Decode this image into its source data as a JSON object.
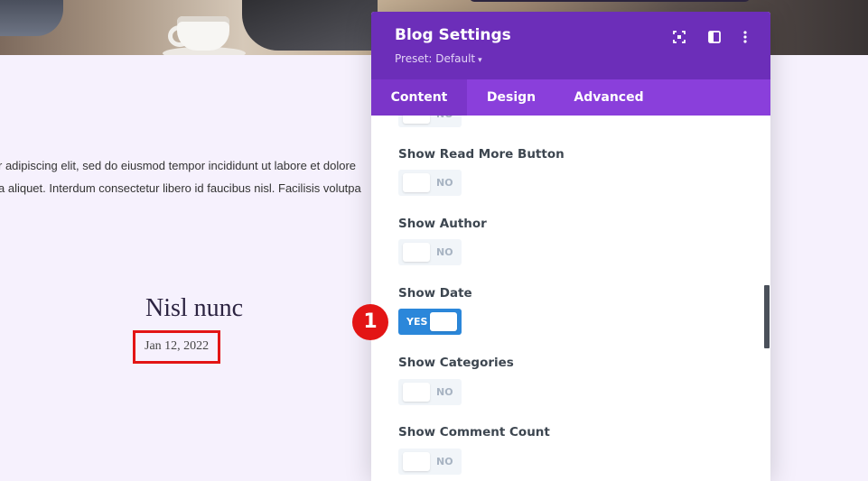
{
  "background": {
    "excerpt_line_1": "r adipiscing elit, sed do eiusmod tempor incididunt ut labore et dolore",
    "excerpt_line_2": "a aliquet. Interdum consectetur libero id faucibus nisl. Facilisis volutpa",
    "post_title": "Nisl nunc",
    "post_date": "Jan 12, 2022",
    "highlight_color": "#e31515"
  },
  "panel": {
    "title": "Blog Settings",
    "preset": "Preset: Default",
    "preset_caret": "▾",
    "header_icons": [
      "fullscreen-icon",
      "sidebar-layout-icon",
      "more-options-icon"
    ],
    "colors": {
      "header": "#6c2eb9",
      "tabbar": "#8a3fdb",
      "toggle_on": "#2b87da"
    },
    "tabs": [
      {
        "label": "Content",
        "active": true
      },
      {
        "label": "Design",
        "active": false
      },
      {
        "label": "Advanced",
        "active": false
      }
    ],
    "partial_toggle_state": "NO",
    "options": [
      {
        "label": "Show Read More Button",
        "state": "NO",
        "enabled": false
      },
      {
        "label": "Show Author",
        "state": "NO",
        "enabled": false
      },
      {
        "label": "Show Date",
        "state": "YES",
        "enabled": true
      },
      {
        "label": "Show Categories",
        "state": "NO",
        "enabled": false
      },
      {
        "label": "Show Comment Count",
        "state": "NO",
        "enabled": false
      }
    ]
  },
  "step_marker": "1"
}
